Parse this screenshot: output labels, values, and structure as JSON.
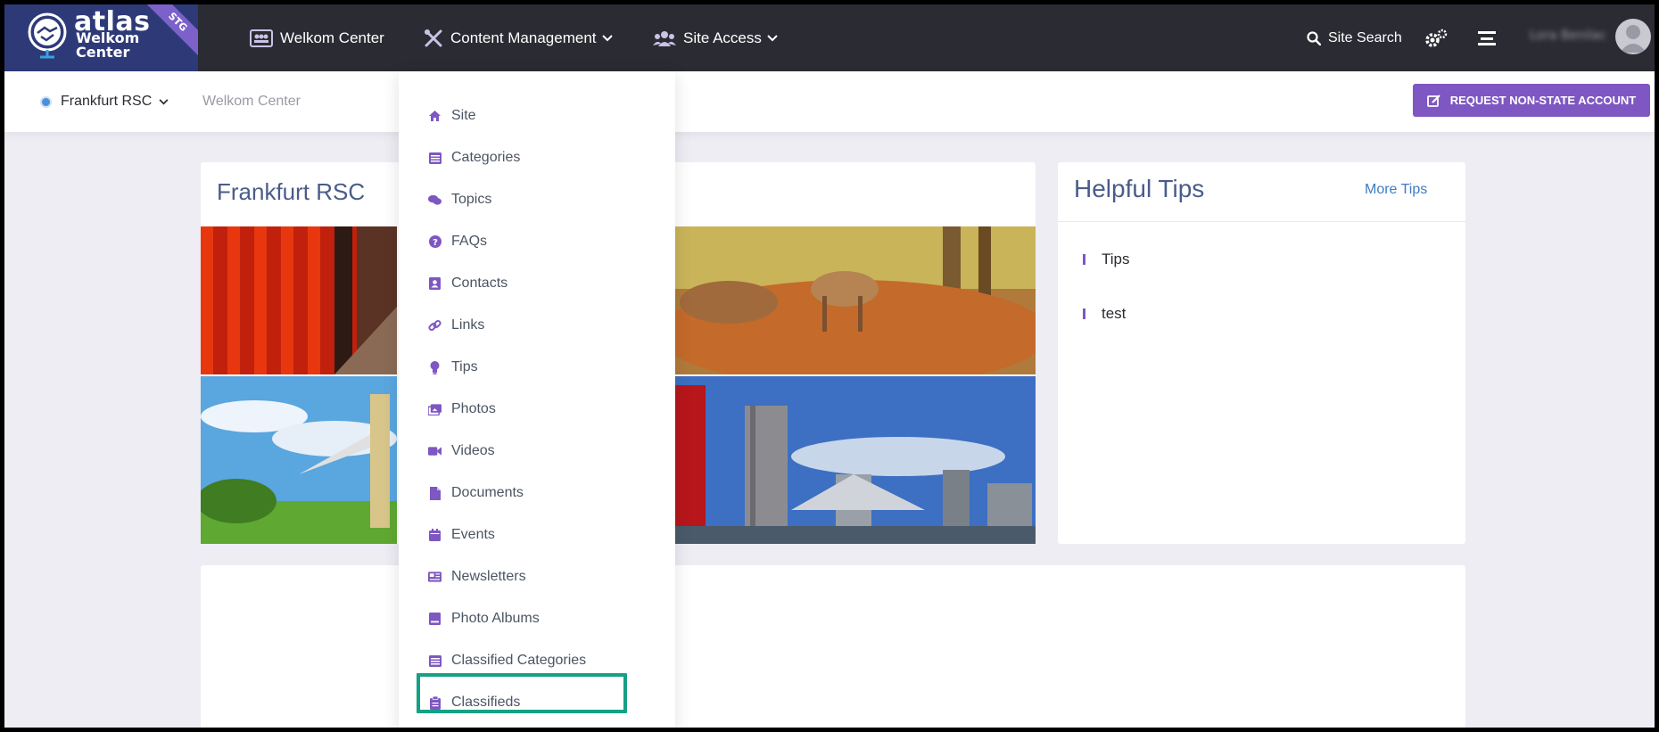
{
  "brand": {
    "logo_word": "atlas",
    "logo_sub_line1": "Welkom",
    "logo_sub_line2": "Center",
    "env_ribbon": "STG"
  },
  "topnav": {
    "home_label": "Welkom Center",
    "content_label": "Content Management",
    "access_label": "Site Access",
    "search_label": "Site Search",
    "username": "Lora Benilac"
  },
  "subheader": {
    "site_selected": "Frankfurt RSC",
    "breadcrumb": "Welkom Center",
    "request_button": "REQUEST NON-STATE ACCOUNT"
  },
  "site_card": {
    "title": "Frankfurt RSC"
  },
  "tips": {
    "title": "Helpful Tips",
    "more_label": "More Tips",
    "items": [
      "Tips",
      "test"
    ]
  },
  "content_menu": {
    "items": [
      {
        "label": "Site",
        "icon": "home-icon"
      },
      {
        "label": "Categories",
        "icon": "list-icon"
      },
      {
        "label": "Topics",
        "icon": "comments-icon"
      },
      {
        "label": "FAQs",
        "icon": "question-icon"
      },
      {
        "label": "Contacts",
        "icon": "contact-card-icon"
      },
      {
        "label": "Links",
        "icon": "link-icon"
      },
      {
        "label": "Tips",
        "icon": "lightbulb-icon"
      },
      {
        "label": "Photos",
        "icon": "images-icon"
      },
      {
        "label": "Videos",
        "icon": "video-icon"
      },
      {
        "label": "Documents",
        "icon": "file-icon"
      },
      {
        "label": "Events",
        "icon": "calendar-icon"
      },
      {
        "label": "Newsletters",
        "icon": "newspaper-icon"
      },
      {
        "label": "Photo Albums",
        "icon": "album-icon"
      },
      {
        "label": "Classified Categories",
        "icon": "list-icon"
      },
      {
        "label": "Classifieds",
        "icon": "clipboard-icon"
      }
    ],
    "highlighted_item": "Classifieds"
  },
  "colors": {
    "nav_bg": "#2b2b33",
    "accent": "#7e57c2",
    "highlight": "#16a085",
    "title_blue": "#4a5c8a",
    "link_blue": "#3d7bc4"
  }
}
